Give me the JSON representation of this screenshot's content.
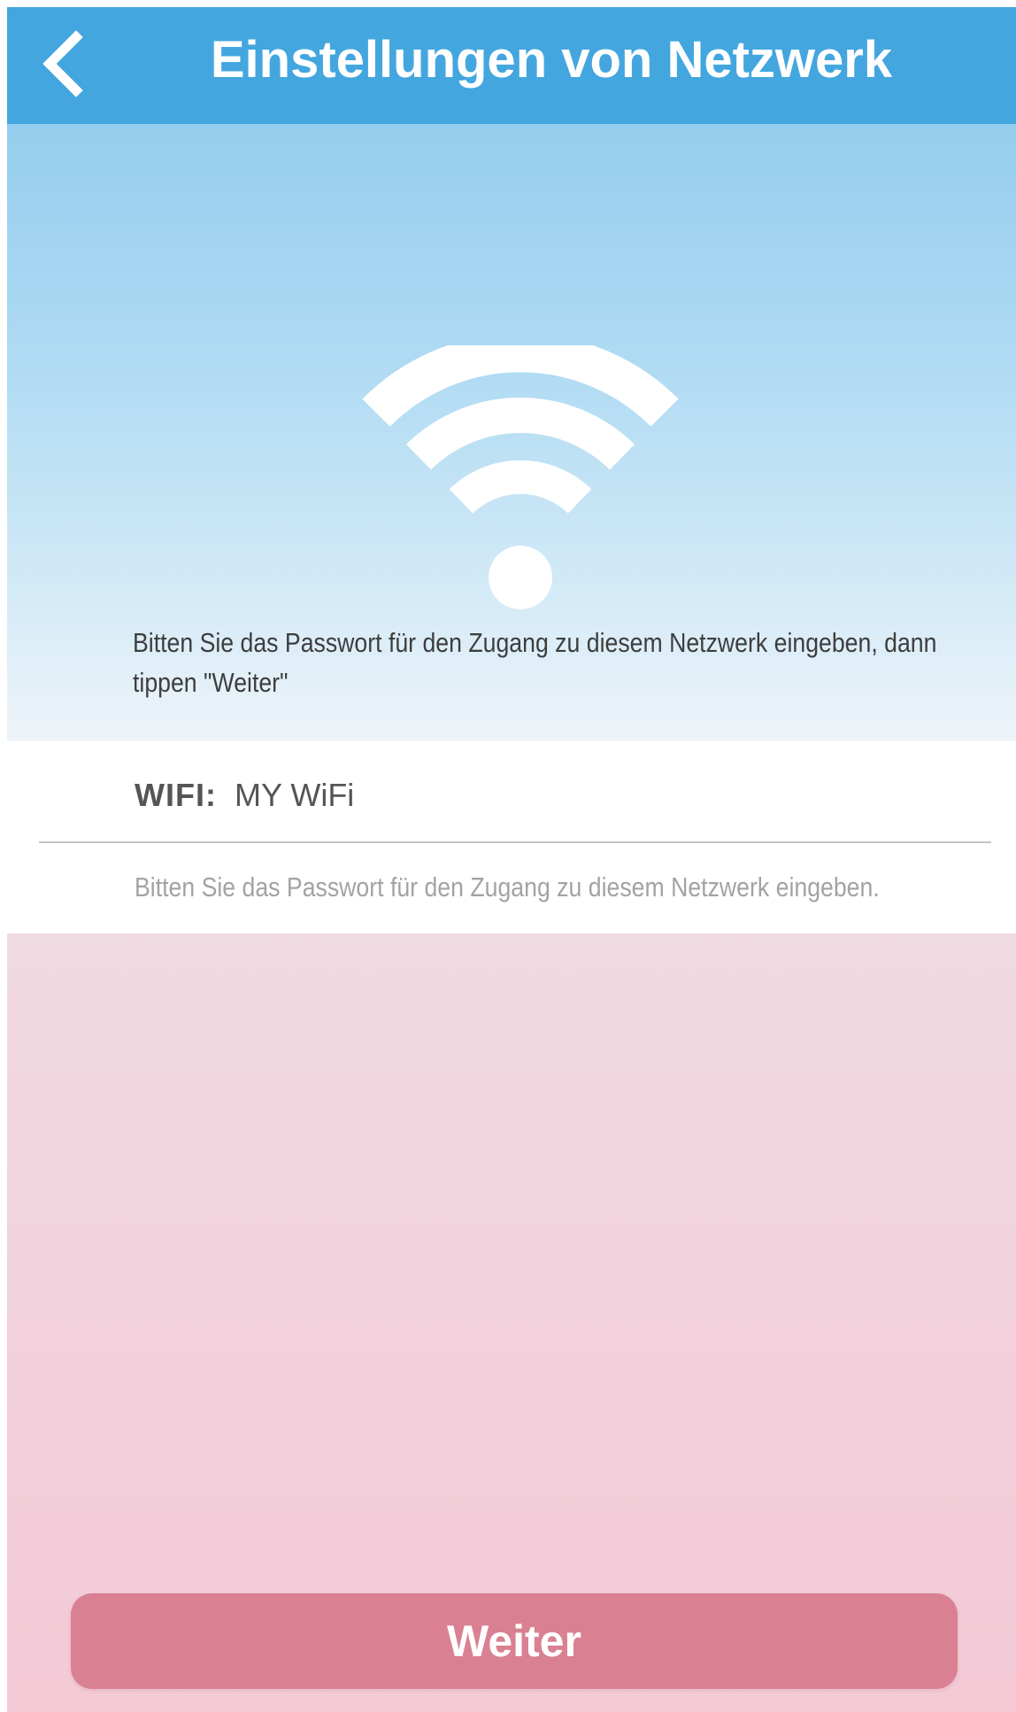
{
  "header": {
    "back_icon": "chevron-left-icon",
    "title": "Einstellungen von Netzwerk"
  },
  "hero": {
    "icon": "wifi-icon",
    "instructions": "Bitten Sie das Passwort für den Zugang zu diesem Netzwerk eingeben, dann tippen \"Weiter\""
  },
  "network": {
    "label": "WIFI:",
    "name": "MY WiFi",
    "password_value": "",
    "password_placeholder": "Bitten Sie das Passwort für den Zugang zu diesem Netzwerk eingeben."
  },
  "footer": {
    "next_label": "Weiter"
  },
  "colors": {
    "header": "#44a6df",
    "button": "#d98192",
    "hero_top": "#95cdee",
    "background_bottom": "#f3c9d6"
  }
}
